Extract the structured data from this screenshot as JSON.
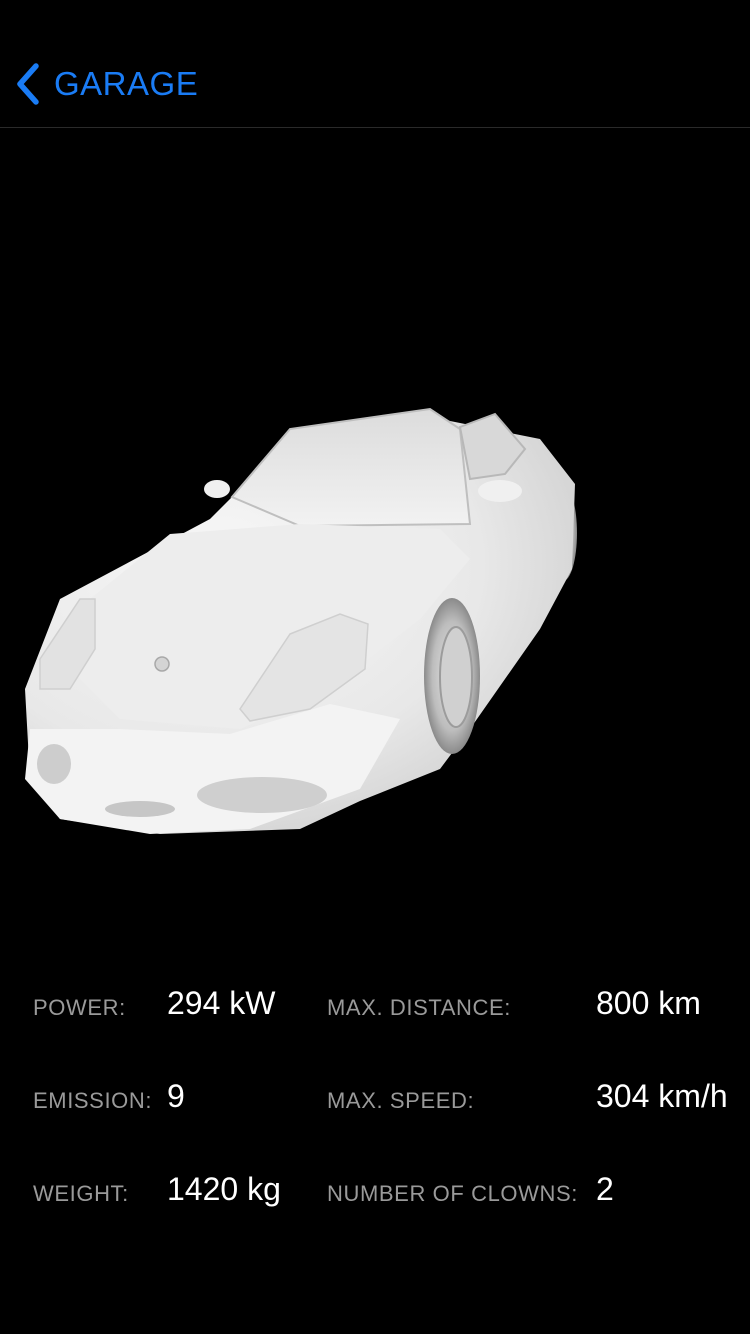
{
  "nav": {
    "back_label": "GARAGE",
    "back_icon": "chevron-left-icon",
    "accent_color": "#1a7cf5"
  },
  "car": {
    "image": "3d-car-model"
  },
  "stats": {
    "power_label": "POWER:",
    "power_value": "294 kW",
    "max_distance_label": "MAX. DISTANCE:",
    "max_distance_value": "800 km",
    "emission_label": "EMISSION:",
    "emission_value": "9",
    "max_speed_label": "MAX. SPEED:",
    "max_speed_value": "304 km/h",
    "weight_label": "WEIGHT:",
    "weight_value": "1420 kg",
    "clowns_label": "NUMBER OF CLOWNS:",
    "clowns_value": "2"
  }
}
